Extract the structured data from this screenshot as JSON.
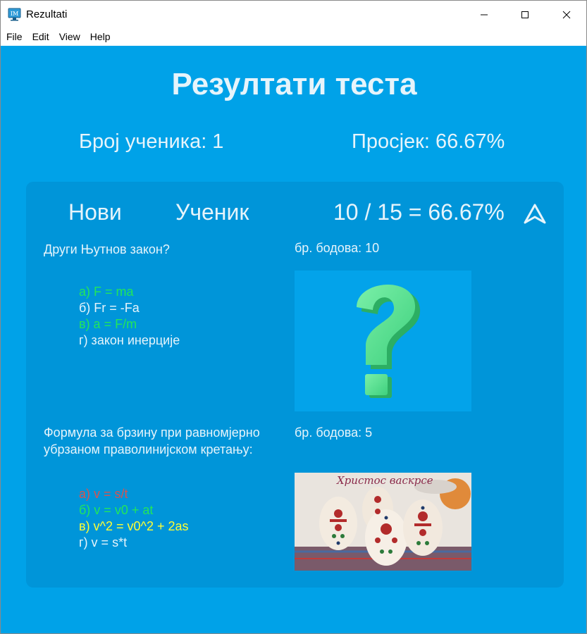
{
  "window": {
    "title": "Rezultati",
    "icon": "app-monitor-icon"
  },
  "menu": {
    "file": "File",
    "edit": "Edit",
    "view": "View",
    "help": "Help"
  },
  "header": {
    "title": "Резултати теста",
    "students_label": "Број ученика: 1",
    "average_label": "Просјек: 66.67%"
  },
  "student": {
    "first_name": "Нови",
    "last_name": "Ученик",
    "score_summary": "10 / 15 = 66.67%",
    "expanded": true
  },
  "questions": [
    {
      "text": "Други Њутнов закон?",
      "points_label": "бр. бодова: 10",
      "image": "question-mark-image",
      "answers": [
        {
          "text": "а) F = ma",
          "state": "correct"
        },
        {
          "text": "б) Fr = -Fa",
          "state": "neutral"
        },
        {
          "text": "в) a = F/m",
          "state": "correct"
        },
        {
          "text": "г) закон инерције",
          "state": "neutral"
        }
      ]
    },
    {
      "text": "Формула за брзину при равномјерно убрзаном праволинијском кретању:",
      "points_label": "бр. бодова: 5",
      "image": "easter-eggs-image",
      "image_caption": "Христос васкрсе",
      "answers": [
        {
          "text": "а) v = s/t",
          "state": "wrong"
        },
        {
          "text": "б) v = v0 + at",
          "state": "correct"
        },
        {
          "text": "в) v^2 = v0^2 + 2as",
          "state": "selected"
        },
        {
          "text": "г) v = s*t",
          "state": "neutral"
        }
      ]
    }
  ],
  "colors": {
    "background": "#00a2e8",
    "panel": "#0095d9",
    "text": "#e6f4fb",
    "correct": "#22e65a",
    "wrong": "#d9534f",
    "selected": "#ffff33"
  }
}
